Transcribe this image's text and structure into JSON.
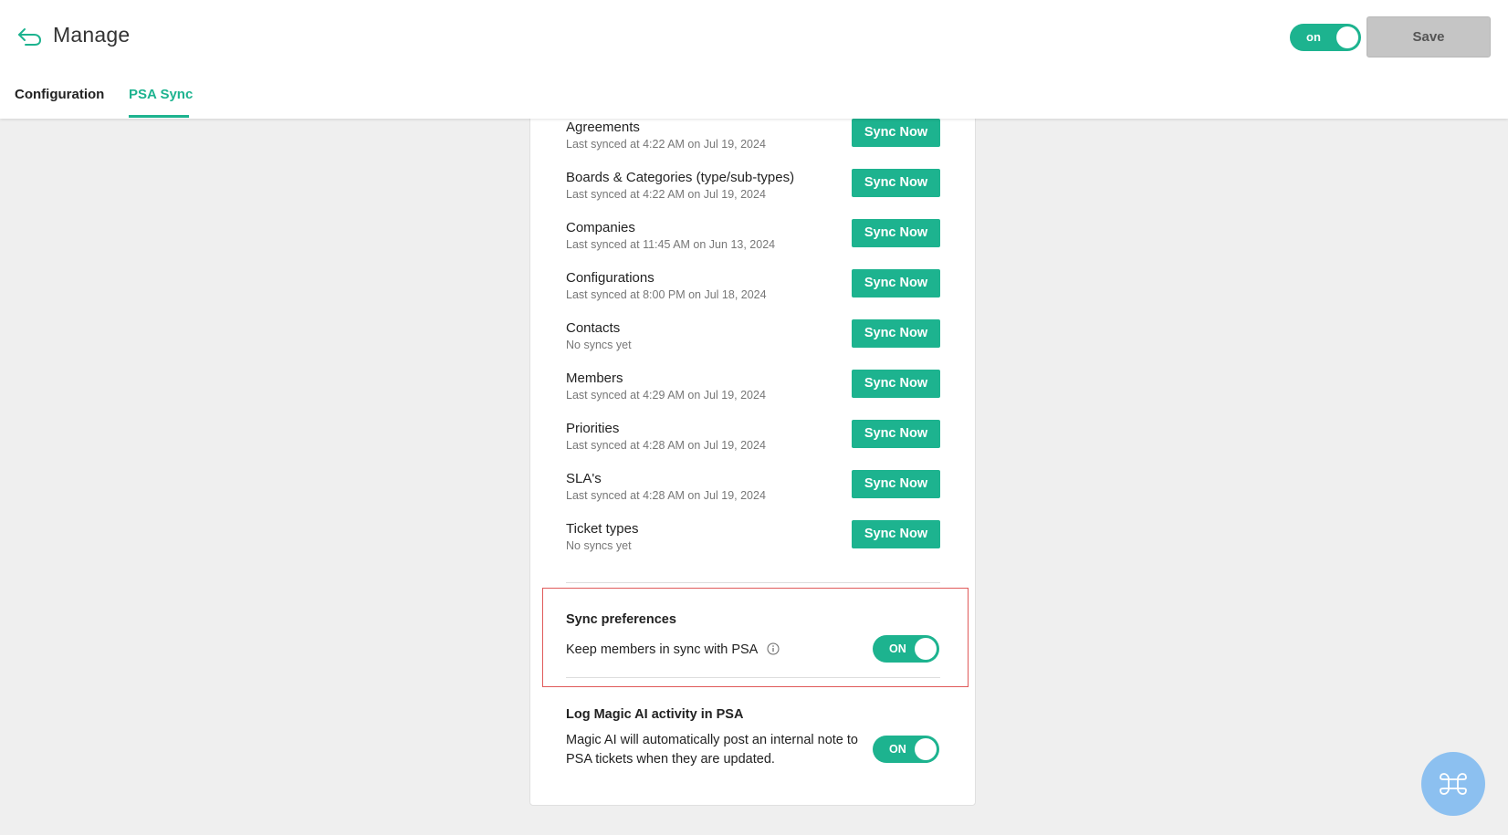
{
  "header": {
    "title": "Manage",
    "master_toggle_label": "on",
    "save_label": "Save"
  },
  "tabs": [
    {
      "label": "Configuration",
      "active": false
    },
    {
      "label": "PSA Sync",
      "active": true
    }
  ],
  "sync_items": [
    {
      "name": "Agreements",
      "status": "Last synced at 4:22 AM on Jul 19, 2024",
      "button": "Sync Now"
    },
    {
      "name": "Boards & Categories (type/sub-types)",
      "status": "Last synced at 4:22 AM on Jul 19, 2024",
      "button": "Sync Now"
    },
    {
      "name": "Companies",
      "status": "Last synced at 11:45 AM on Jun 13, 2024",
      "button": "Sync Now"
    },
    {
      "name": "Configurations",
      "status": "Last synced at 8:00 PM on Jul 18, 2024",
      "button": "Sync Now"
    },
    {
      "name": "Contacts",
      "status": "No syncs yet",
      "button": "Sync Now"
    },
    {
      "name": "Members",
      "status": "Last synced at 4:29 AM on Jul 19, 2024",
      "button": "Sync Now"
    },
    {
      "name": "Priorities",
      "status": "Last synced at 4:28 AM on Jul 19, 2024",
      "button": "Sync Now"
    },
    {
      "name": "SLA's",
      "status": "Last synced at 4:28 AM on Jul 19, 2024",
      "button": "Sync Now"
    },
    {
      "name": "Ticket types",
      "status": "No syncs yet",
      "button": "Sync Now"
    }
  ],
  "sync_preferences": {
    "title": "Sync preferences",
    "keep_members_label": "Keep members in sync with PSA",
    "toggle_label": "ON"
  },
  "log_magic": {
    "title": "Log Magic AI activity in PSA",
    "description": "Magic AI will automatically post an internal note to PSA tickets when they are updated.",
    "toggle_label": "ON"
  },
  "colors": {
    "accent": "#1db38f",
    "highlight": "#e05a5a",
    "fab": "#8cc0f0"
  },
  "icons": {
    "back": "back-arrow-icon",
    "info": "info-icon",
    "fab": "command-icon"
  }
}
